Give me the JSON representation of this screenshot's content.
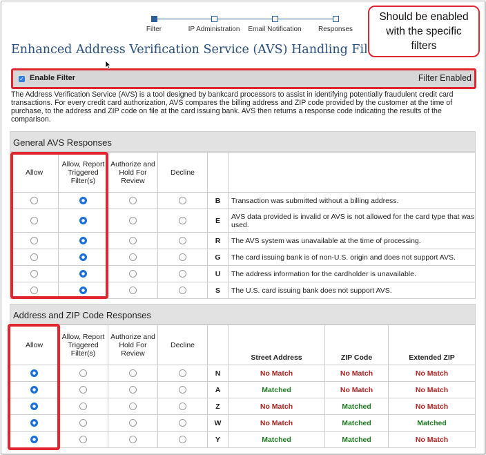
{
  "stepper": {
    "steps": [
      "Filter",
      "IP Administration",
      "Email Notification",
      "Responses"
    ],
    "active_index": 0
  },
  "page_title": "Enhanced Address Verification Service (AVS) Handling Filter",
  "callout": {
    "line1": "Should be enabled",
    "line2": "with the specific",
    "line3": "filters"
  },
  "enable_filter": {
    "label": "Enable Filter",
    "checked": true,
    "status": "Filter Enabled"
  },
  "description": "The Address Verification Service (AVS) is a tool designed by bankcard processors to assist in identifying potentially fraudulent credit card transactions. For every credit card authorization, AVS compares the billing address and ZIP code provided by the customer at the time of purchase, to the address and ZIP code on file at the card issuing bank. AVS then returns a response code indicating the results of the comparison.",
  "general": {
    "title": "General AVS Responses",
    "headers": [
      "Allow",
      "Allow, Report Triggered Filter(s)",
      "Authorize and Hold For Review",
      "Decline"
    ],
    "rows": [
      {
        "code": "B",
        "text": "Transaction was submitted without a billing address.",
        "selected": 1
      },
      {
        "code": "E",
        "text": "AVS data provided is invalid or AVS is not allowed for the card type that was used.",
        "selected": 1
      },
      {
        "code": "R",
        "text": "The AVS system was unavailable at the time of processing.",
        "selected": 1
      },
      {
        "code": "G",
        "text": "The card issuing bank is of non-U.S. origin and does not support AVS.",
        "selected": 1
      },
      {
        "code": "U",
        "text": "The address information for the cardholder is unavailable.",
        "selected": 1
      },
      {
        "code": "S",
        "text": "The U.S. card issuing bank does not support AVS.",
        "selected": 1
      }
    ]
  },
  "zip": {
    "title": "Address and ZIP Code Responses",
    "headers": [
      "Allow",
      "Allow, Report Triggered Filter(s)",
      "Authorize and Hold For Review",
      "Decline"
    ],
    "match_headers": [
      "Street Address",
      "ZIP Code",
      "Extended ZIP"
    ],
    "rows": [
      {
        "code": "N",
        "selected": 0,
        "street": "No Match",
        "zip": "No Match",
        "ext": "No Match"
      },
      {
        "code": "A",
        "selected": 0,
        "street": "Matched",
        "zip": "No Match",
        "ext": "No Match"
      },
      {
        "code": "Z",
        "selected": 0,
        "street": "No Match",
        "zip": "Matched",
        "ext": "No Match"
      },
      {
        "code": "W",
        "selected": 0,
        "street": "No Match",
        "zip": "Matched",
        "ext": "Matched"
      },
      {
        "code": "Y",
        "selected": 0,
        "street": "Matched",
        "zip": "Matched",
        "ext": "No Match"
      }
    ]
  },
  "colors": {
    "accent": "#2b5f97",
    "highlight": "#e0262e",
    "match": "#1f7a22",
    "no_match": "#b0221f"
  }
}
